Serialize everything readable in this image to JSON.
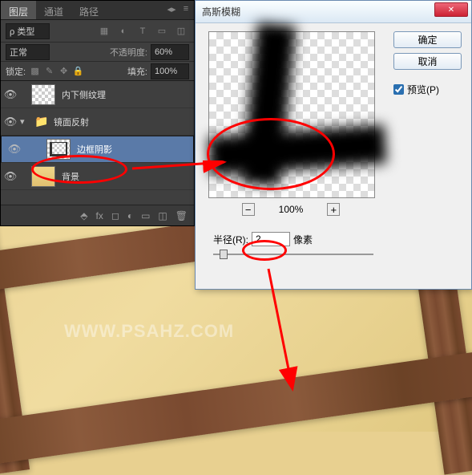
{
  "panel": {
    "tabs": [
      "图层",
      "通道",
      "路径"
    ],
    "filter_label": "ρ 类型",
    "blend_mode": "正常",
    "opacity_label": "不透明度:",
    "opacity_value": "60%",
    "lock_label": "锁定:",
    "fill_label": "填充:",
    "fill_value": "100%",
    "layers": [
      {
        "name": "内下侧纹理"
      },
      {
        "name": "镜面反射"
      },
      {
        "name": "边框阴影"
      },
      {
        "name": "背景"
      }
    ]
  },
  "dialog": {
    "title": "高斯模糊",
    "ok": "确定",
    "cancel": "取消",
    "preview_chk": "预览(P)",
    "zoom": "100%",
    "radius_label": "半径(R):",
    "radius_value": "2",
    "radius_unit": "像素"
  },
  "watermark": "WWW.PSAHZ.COM",
  "chart_data": {
    "type": "none"
  }
}
